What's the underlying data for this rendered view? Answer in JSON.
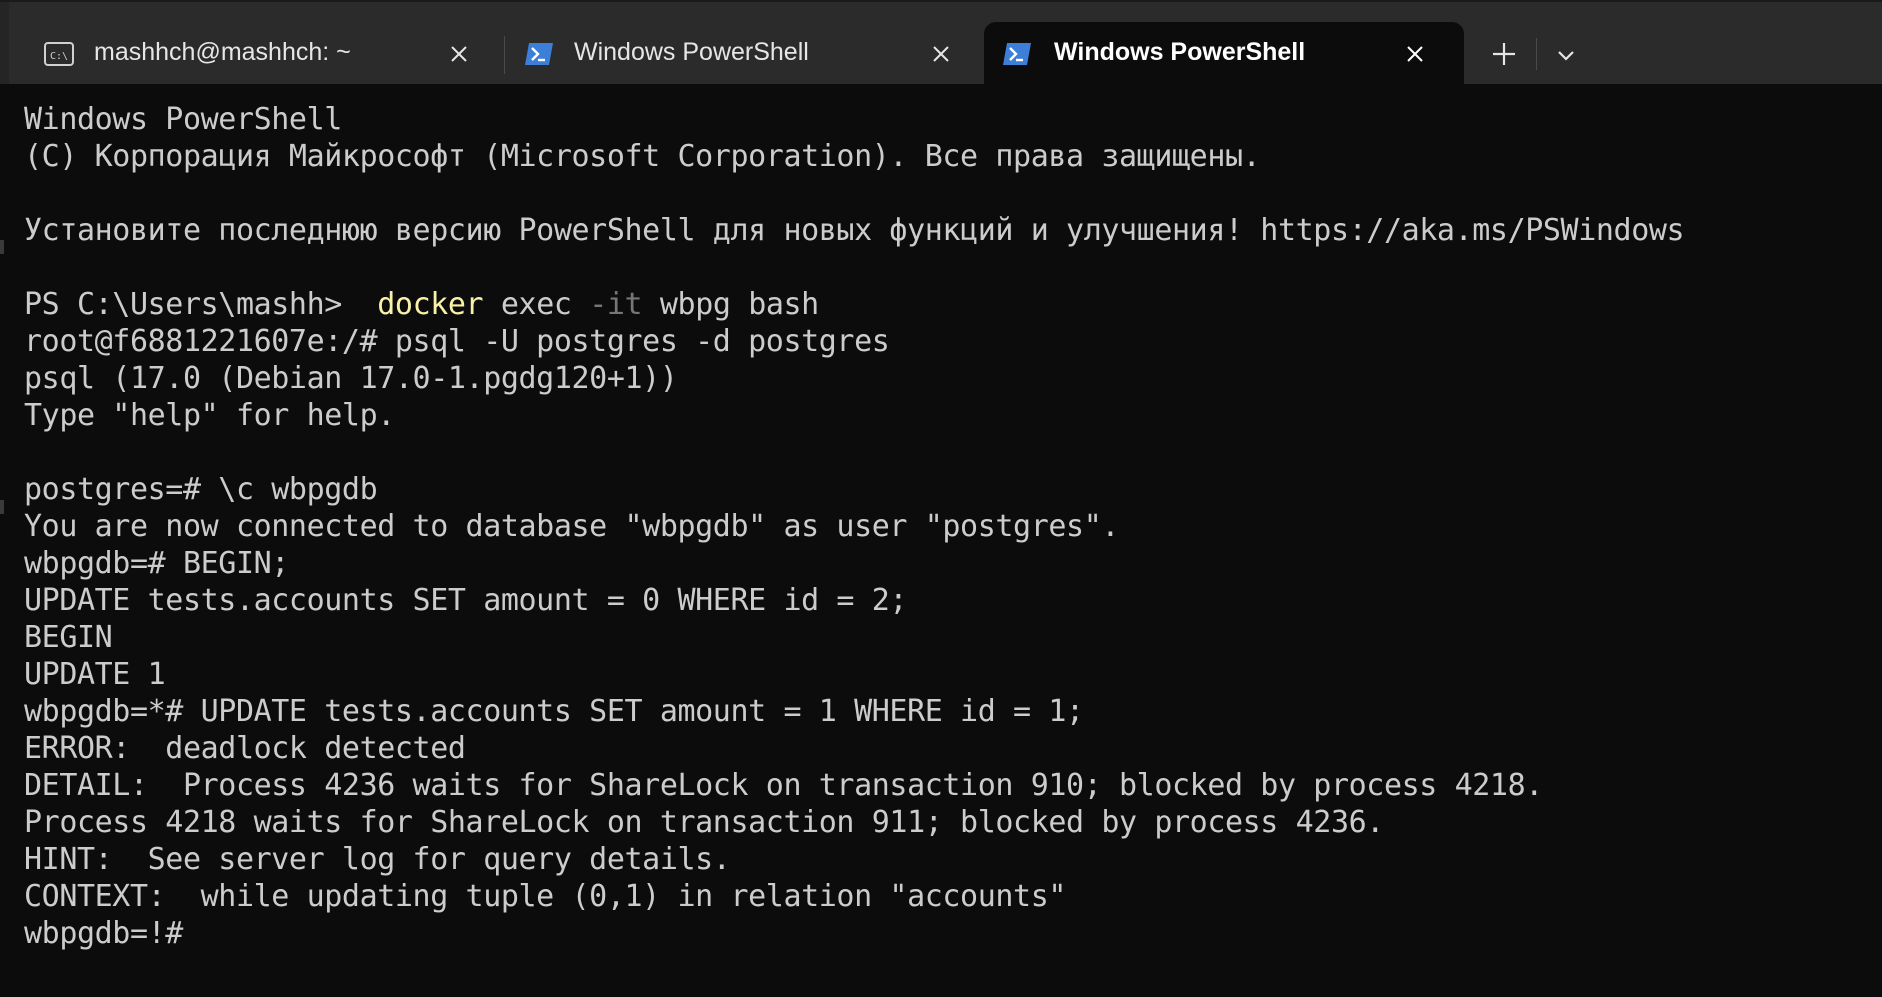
{
  "tabs": [
    {
      "label": "mashhch@mashhch: ~",
      "icon": "terminal-icon",
      "active": false
    },
    {
      "label": "Windows PowerShell",
      "icon": "powershell-icon",
      "active": false
    },
    {
      "label": "Windows PowerShell",
      "icon": "powershell-icon",
      "active": true
    }
  ],
  "tab_actions": {
    "new_tab": "+",
    "dropdown": "chevron-down"
  },
  "colors": {
    "background": "#0c0c0c",
    "tabbar": "#2b2b2b",
    "text": "#cccccc",
    "command": "#f9f1a5",
    "flag": "#767676",
    "powershell_blue": "#3c7ed8"
  },
  "terminal": {
    "banner_title": "Windows PowerShell",
    "banner_copyright": "(C) Корпорация Майкрософт (Microsoft Corporation). Все права защищены.",
    "banner_update": "Установите последнюю версию PowerShell для новых функций и улучшения! https://aka.ms/PSWindows",
    "ps_prompt": "PS C:\\Users\\mashh> ",
    "ps_command": "docker",
    "ps_args1": " exec ",
    "ps_flag": "-it",
    "ps_args2": " wbpg bash",
    "line_root": "root@f6881221607e:/# psql -U postgres -d postgres",
    "line_psql_version": "psql (17.0 (Debian 17.0-1.pgdg120+1))",
    "line_help": "Type \"help\" for help.",
    "line_connect_cmd": "postgres=# \\c wbpgdb",
    "line_connected": "You are now connected to database \"wbpgdb\" as user \"postgres\".",
    "line_begin_cmd": "wbpgdb=# BEGIN;",
    "line_update_cmd": "UPDATE tests.accounts SET amount = 0 WHERE id = 2;",
    "line_begin_out": "BEGIN",
    "line_update_out": "UPDATE 1",
    "line_update2_cmd": "wbpgdb=*# UPDATE tests.accounts SET amount = 1 WHERE id = 1;",
    "line_error": "ERROR:  deadlock detected",
    "line_detail": "DETAIL:  Process 4236 waits for ShareLock on transaction 910; blocked by process 4218.",
    "line_detail2": "Process 4218 waits for ShareLock on transaction 911; blocked by process 4236.",
    "line_hint": "HINT:  See server log for query details.",
    "line_context": "CONTEXT:  while updating tuple (0,1) in relation \"accounts\"",
    "line_final_prompt": "wbpgdb=!# "
  }
}
